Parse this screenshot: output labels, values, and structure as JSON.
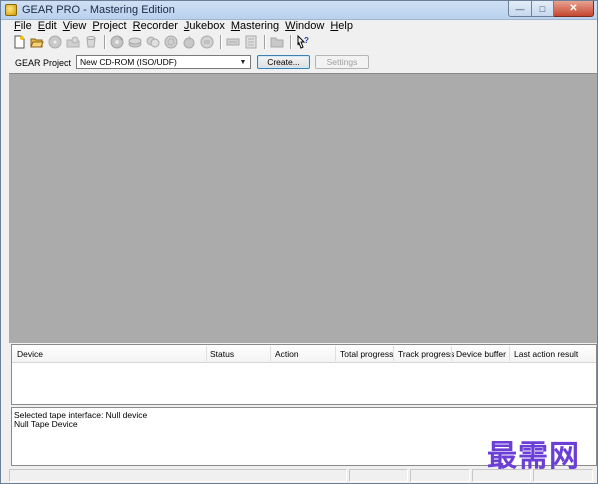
{
  "window": {
    "title": "GEAR PRO - Mastering Edition"
  },
  "menus": [
    {
      "u": "F",
      "rest": "ile"
    },
    {
      "u": "E",
      "rest": "dit"
    },
    {
      "u": "V",
      "rest": "iew"
    },
    {
      "u": "P",
      "rest": "roject"
    },
    {
      "u": "R",
      "rest": "ecorder"
    },
    {
      "u": "J",
      "rest": "ukebox"
    },
    {
      "u": "M",
      "rest": "astering"
    },
    {
      "u": "W",
      "rest": "indow"
    },
    {
      "u": "H",
      "rest": "elp"
    }
  ],
  "project": {
    "label": "GEAR Project",
    "selected": "New CD-ROM (ISO/UDF)",
    "create_label": "Create...",
    "settings_label": "Settings"
  },
  "device_table": {
    "columns": [
      "Device",
      "Status",
      "Action",
      "Total progress",
      "Track progress",
      "Device buffer",
      "Last action result"
    ]
  },
  "log": {
    "lines": [
      "Selected tape interface: Null device",
      "Null Tape Device"
    ]
  },
  "watermark": "最需网",
  "colors": {
    "workspace": "#ababab",
    "accent_button": "#3c7fb1",
    "watermark": "#6b3fd6"
  },
  "toolbar_icons": [
    "new-document-icon",
    "open-folder-icon",
    "disc-icon",
    "folder-open-disc-icon",
    "cup-icon",
    "disc-recorder-icon",
    "disc-stack-icon",
    "disc-copy-icon",
    "disc-gear-icon",
    "disc-burn-icon",
    "disc-label-icon",
    "drive-tray-icon",
    "drive-list-icon",
    "folder-icon",
    "help-pointer-icon"
  ]
}
